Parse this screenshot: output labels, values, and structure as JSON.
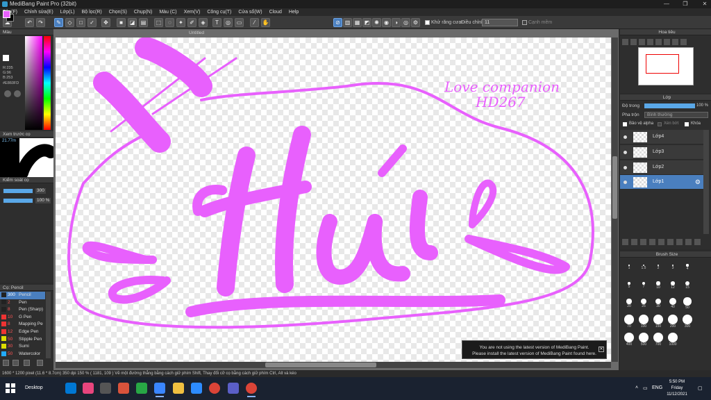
{
  "window": {
    "title": "MediBang Paint Pro (32bit)"
  },
  "menu": [
    "Tệp(F)",
    "Chỉnh sửa(E)",
    "Lớp(L)",
    "Bộ lọc(R)",
    "Chọn(S)",
    "Chụp(N)",
    "Màu (C)",
    "Xem(V)",
    "Công cụ(T)",
    "Cửa sổ(W)",
    "Cloud",
    "Help"
  ],
  "toolbar": {
    "antialias_label": "Khử răng cưa",
    "adjust_label": "Điều chỉnh",
    "adjust_value": "11",
    "edge_label": "Cạnh mềm"
  },
  "panels": {
    "color": {
      "title": "Màu",
      "rgb": "R:235\nG:96\nB:253",
      "hex": "#E860FD",
      "fg": "#e860fd"
    },
    "preview": {
      "title": "Xem trước cọ",
      "size": "21.77m"
    },
    "control": {
      "title": "Kiểm soát cọ",
      "size_value": "300",
      "opacity_value": "100 %"
    },
    "brush": {
      "title": "Cọ: Pencil",
      "items": [
        {
          "size": "300",
          "name": "Pencil",
          "color": "#222"
        },
        {
          "size": "2",
          "name": "Pen",
          "color": "#222"
        },
        {
          "size": "8",
          "name": "Pen (Sharp)",
          "color": "#222"
        },
        {
          "size": "10",
          "name": "G Pen",
          "color": "#e33"
        },
        {
          "size": "8",
          "name": "Mapping Pe",
          "color": "#e33"
        },
        {
          "size": "12",
          "name": "Edge Pen",
          "color": "#e33"
        },
        {
          "size": "50",
          "name": "Stipple Pen",
          "color": "#dd0"
        },
        {
          "size": "30",
          "name": "Sumi",
          "color": "#dd0"
        },
        {
          "size": "50",
          "name": "Watercolor",
          "color": "#2af"
        }
      ]
    },
    "navigator": {
      "title": "Hoa tiêu"
    },
    "layer": {
      "title": "Lớp",
      "opacity_label": "Độ trong",
      "opacity_value": "100 %",
      "blend_label": "Pha trộn",
      "blend_value": "Bình thường",
      "protect_alpha": "Bảo vệ alpha",
      "clipping": "Xén bớt",
      "lock": "Khóa",
      "items": [
        "Lớp4",
        "Lớp3",
        "Lớp2",
        "Lớp1"
      ]
    },
    "brush_size": {
      "title": "Brush Size",
      "sizes": [
        "1",
        "1.5",
        "2",
        "3",
        "4",
        "5",
        "7",
        "10",
        "12",
        "15",
        "20",
        "25",
        "30",
        "40",
        "50",
        "70",
        "100",
        "150",
        "200",
        "300",
        "400",
        "500",
        "700",
        "1000"
      ]
    }
  },
  "canvas": {
    "tab": "Untitled",
    "artwork_text": "Hú",
    "caption_line1": "Love companion",
    "caption_line2": "HD267",
    "ink_color": "#e860fd"
  },
  "notice": {
    "line1": "You are not using the latest version of MediBang Paint.",
    "line2": "Please install the latest version of MediBang Paint found here."
  },
  "status": "1600 * 1200 pixel   (11.6 * 8.7cm)   350 dpi   150 %   ( 1181, 109 )   Vẽ một đường thẳng bằng cách giữ phím Shift, Thay đổi cỡ cọ bằng cách giữ phím Ctrl, Alt và kéo",
  "taskbar": {
    "desktop_label": "Desktop",
    "lang": "ENG",
    "time": "5:50 PM",
    "day": "Friday",
    "date": "11/12/2021"
  }
}
